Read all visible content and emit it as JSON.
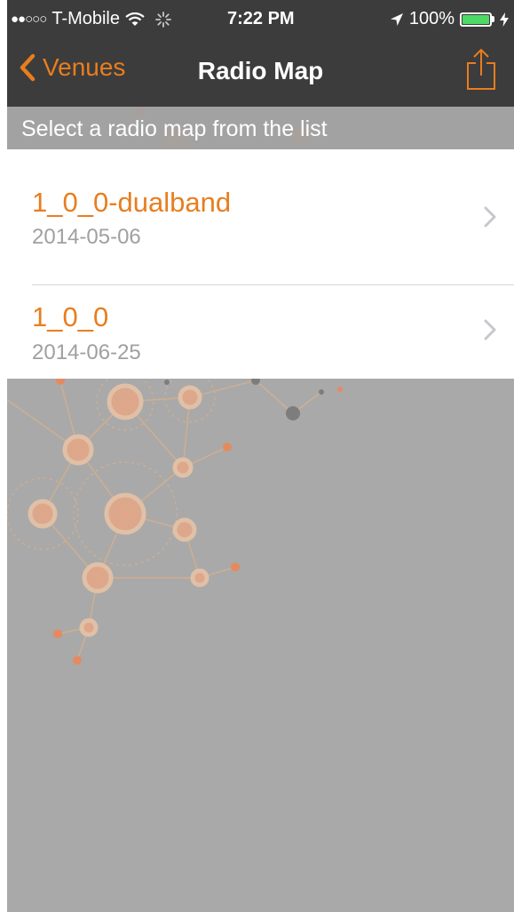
{
  "status_bar": {
    "signal": "●●○○○",
    "carrier": "T-Mobile",
    "time": "7:22 PM",
    "battery": "100%",
    "battery_level": 1.0
  },
  "nav": {
    "back_label": "Venues",
    "title": "Radio Map"
  },
  "banner": {
    "text": "Select a radio map from the list"
  },
  "list": {
    "items": [
      {
        "title": "1_0_0-dualband",
        "date": "2014-05-06"
      },
      {
        "title": "1_0_0",
        "date": "2014-06-25"
      }
    ]
  },
  "colors": {
    "accent": "#e87e1e",
    "bar_background": "#3c3c3c",
    "screen_background": "#a9a9a9"
  },
  "icons": [
    "wifi-icon",
    "activity-spinner-icon",
    "location-arrow-icon",
    "battery-icon",
    "charging-bolt-icon",
    "chevron-left-icon",
    "share-icon",
    "chevron-right-icon"
  ]
}
